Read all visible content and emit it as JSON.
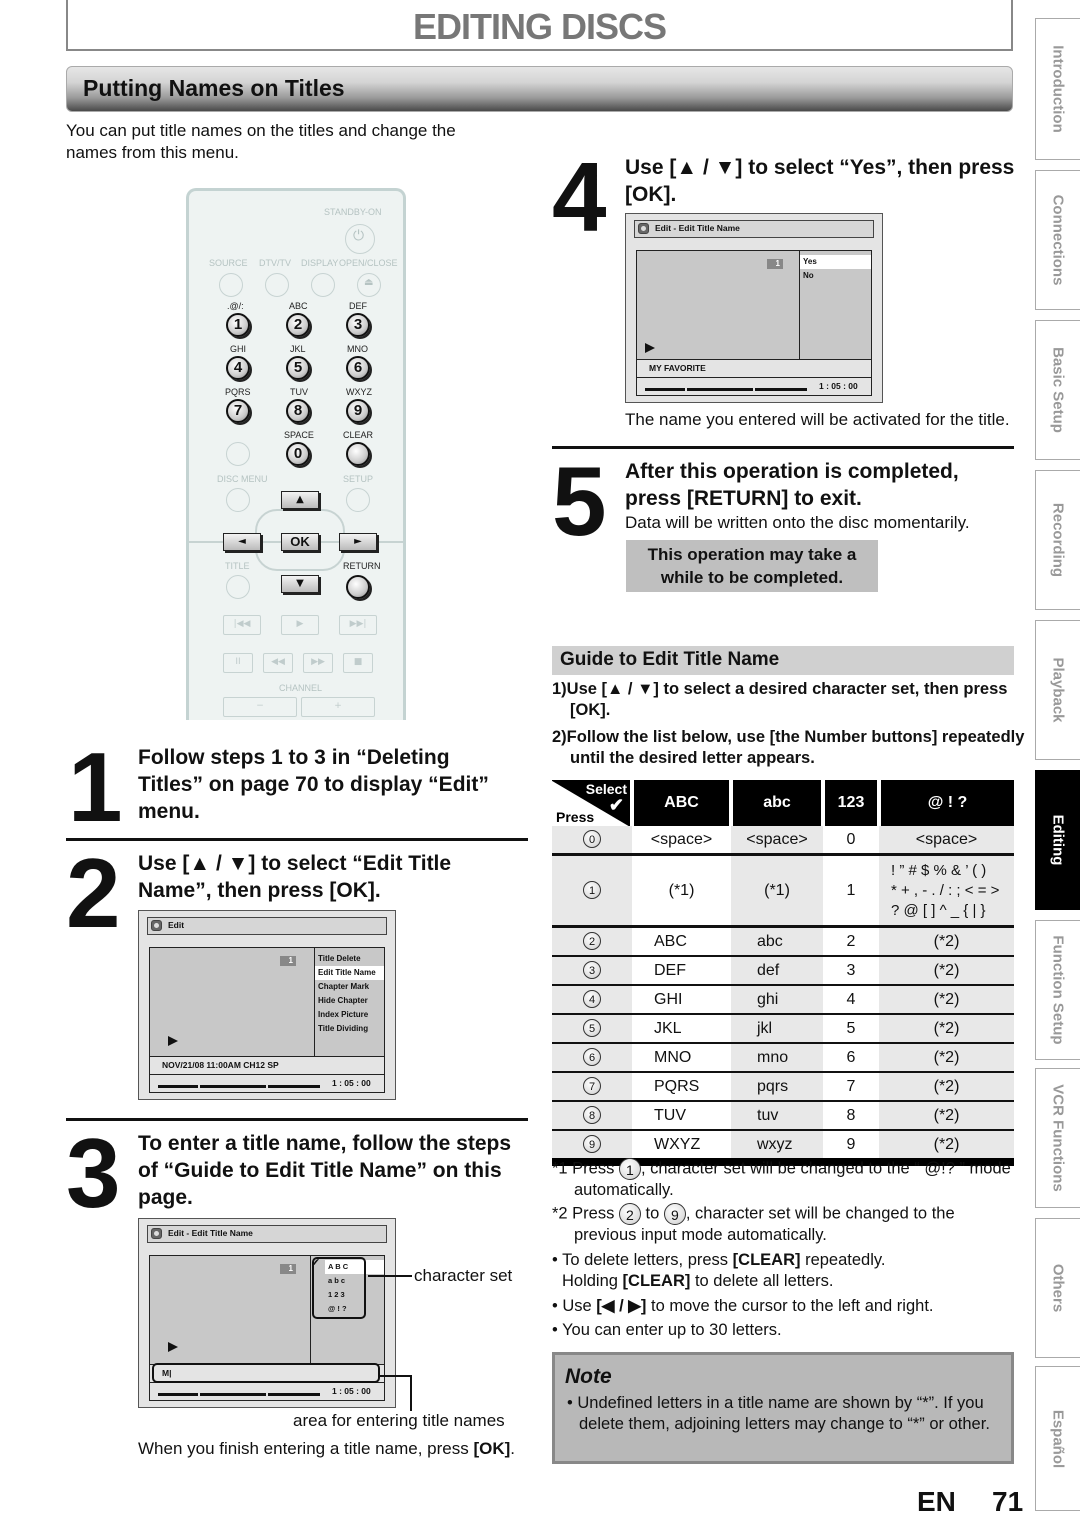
{
  "header": {
    "title": "EDITING DISCS"
  },
  "section": {
    "title": "Putting Names on Titles"
  },
  "intro": "You can put title names on the titles and change the names from this menu.",
  "remote": {
    "top_labels": [
      "STANDBY-ON",
      "SOURCE",
      "DTV/TV",
      "DISPLAY",
      "OPEN/CLOSE"
    ],
    "number_buttons": [
      {
        "num": "1",
        "letters": ".@/:"
      },
      {
        "num": "2",
        "letters": "ABC"
      },
      {
        "num": "3",
        "letters": "DEF"
      },
      {
        "num": "4",
        "letters": "GHI"
      },
      {
        "num": "5",
        "letters": "JKL"
      },
      {
        "num": "6",
        "letters": "MNO"
      },
      {
        "num": "7",
        "letters": "PQRS"
      },
      {
        "num": "8",
        "letters": "TUV"
      },
      {
        "num": "9",
        "letters": "WXYZ"
      },
      {
        "num": "0",
        "letters": "SPACE"
      }
    ],
    "clear_label": "CLEAR",
    "disc_menu_label": "DISC MENU",
    "setup_label": "SETUP",
    "ok_label": "OK",
    "title_label": "TITLE",
    "return_label": "RETURN",
    "channel_label": "CHANNEL",
    "channel_minus": "−",
    "channel_plus": "+",
    "up": "▲",
    "down": "▼",
    "left": "◄",
    "right": "►",
    "transport": [
      "|◀◀",
      "▶",
      "▶▶|",
      "II",
      "◀◀",
      "▶▶",
      "■"
    ]
  },
  "steps": [
    {
      "num": "1",
      "text": "Follow steps 1 to 3 in “Deleting Titles” on page 70 to display “Edit” menu."
    },
    {
      "num": "2",
      "text": "Use [▲ / ▼] to select “Edit Title Name”, then press [OK]."
    },
    {
      "num": "3",
      "text": "To enter a title name, follow the steps of “Guide to Edit Title Name” on this page."
    },
    {
      "num": "4",
      "text": "Use [▲ / ▼] to select “Yes”, then press [OK]."
    },
    {
      "num": "5",
      "text": "After this operation is completed, press [RETURN] to exit."
    }
  ],
  "osd_edit": {
    "title": "Edit",
    "badge": "1",
    "menu": [
      "Title Delete",
      "Edit Title Name",
      "Chapter Mark",
      "Hide Chapter",
      "Index Picture",
      "Title Dividing"
    ],
    "selected_index": 1,
    "info": "NOV/21/08 11:00AM CH12 SP",
    "time": "1 : 05 : 00"
  },
  "osd_name": {
    "title": "Edit - Edit Title Name",
    "badge": "1",
    "charsets": [
      "A  B  C",
      "a  b  c",
      "1  2  3",
      "@  !  ?"
    ],
    "selected_index": 0,
    "check": "✔",
    "entry": "M|",
    "time": "1 : 05 : 00",
    "callout_charset": "character set",
    "callout_entry": "area for entering title names"
  },
  "step3_footer": {
    "text": "When you finish entering a title name, press ",
    "bold": "[OK]",
    "end": "."
  },
  "osd_confirm": {
    "title": "Edit - Edit Title Name",
    "badge": "1",
    "options": [
      "Yes",
      "No"
    ],
    "selected_index": 0,
    "info": "MY FAVORITE",
    "time": "1 : 05 : 00"
  },
  "step4_caption": "The name you entered will be activated for the title.",
  "step5_sub": "Data will be written onto the disc momentarily.",
  "step5_box": "This operation may take a while to be completed.",
  "guide": {
    "title": "Guide to Edit Title Name",
    "steps": [
      "1)Use [▲ / ▼] to select a desired character set, then press [OK].",
      "2)Follow the list below, use [the Number buttons] repeatedly until the desired letter appears."
    ]
  },
  "char_table": {
    "corner_select": "Select",
    "corner_press": "Press",
    "headers": [
      "ABC",
      "abc",
      "123",
      "@ ! ?"
    ],
    "rows": [
      {
        "press": "0",
        "cells": [
          "<space>",
          "<space>",
          "0",
          "<space>"
        ]
      },
      {
        "press": "1",
        "cells": [
          "(*1)",
          "(*1)",
          "1",
          "! ” # $ % & ’ ( )\n* + , - . / : ; < = >\n? @ [ ] ^ _ { | }"
        ]
      },
      {
        "press": "2",
        "cells": [
          "ABC",
          "abc",
          "2",
          "(*2)"
        ]
      },
      {
        "press": "3",
        "cells": [
          "DEF",
          "def",
          "3",
          "(*2)"
        ]
      },
      {
        "press": "4",
        "cells": [
          "GHI",
          "ghi",
          "4",
          "(*2)"
        ]
      },
      {
        "press": "5",
        "cells": [
          "JKL",
          "jkl",
          "5",
          "(*2)"
        ]
      },
      {
        "press": "6",
        "cells": [
          "MNO",
          "mno",
          "6",
          "(*2)"
        ]
      },
      {
        "press": "7",
        "cells": [
          "PQRS",
          "pqrs",
          "7",
          "(*2)"
        ]
      },
      {
        "press": "8",
        "cells": [
          "TUV",
          "tuv",
          "8",
          "(*2)"
        ]
      },
      {
        "press": "9",
        "cells": [
          "WXYZ",
          "wxyz",
          "9",
          "(*2)"
        ]
      }
    ]
  },
  "footnotes": {
    "n1_prefix": "*1 Press ",
    "n1_btn": "1",
    "n1_text": ", character set will be changed to the “ @!? ” mode automatically.",
    "n2_prefix": "*2 Press ",
    "n2_btn_a": "2",
    "n2_mid": " to ",
    "n2_btn_b": "9",
    "n2_text": ", character set will be changed to the previous input mode automatically.",
    "b1_a": "• To delete letters, press ",
    "b1_bold": "[CLEAR]",
    "b1_b": " repeatedly.",
    "b1_c": "Holding ",
    "b1_bold2": "[CLEAR]",
    "b1_d": " to delete all letters.",
    "b2_a": "• Use ",
    "b2_bold": "[◀ / ▶]",
    "b2_b": " to move the cursor to the left and right.",
    "b3": "• You can enter up to 30 letters."
  },
  "note": {
    "title": "Note",
    "text": "• Undefined letters in a title name are shown by “*”. If you delete them, adjoining letters may change to “*” or other."
  },
  "page": {
    "lang": "EN",
    "number": "71"
  },
  "side_tabs": [
    {
      "label": "Introduction",
      "active": false
    },
    {
      "label": "Connections",
      "active": false
    },
    {
      "label": "Basic Setup",
      "active": false
    },
    {
      "label": "Recording",
      "active": false
    },
    {
      "label": "Playback",
      "active": false
    },
    {
      "label": "Editing",
      "active": true
    },
    {
      "label": "Function Setup",
      "active": false
    },
    {
      "label": "VCR Functions",
      "active": false
    },
    {
      "label": "Others",
      "active": false
    },
    {
      "label": "Español",
      "active": false
    }
  ]
}
